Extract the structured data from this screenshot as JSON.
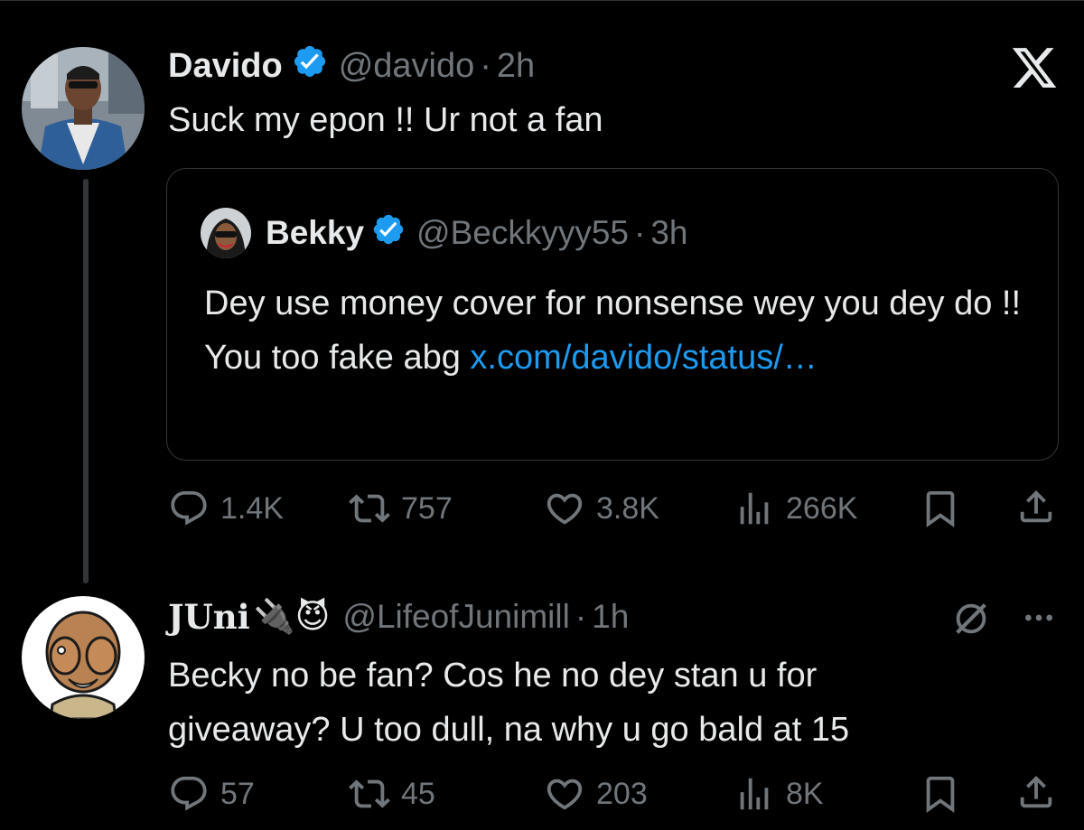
{
  "main_tweet": {
    "name": "Davido",
    "handle": "@davido",
    "sep": "·",
    "time": "2h",
    "text": "Suck my epon !! Ur not a fan",
    "stats": {
      "replies": "1.4K",
      "reposts": "757",
      "likes": "3.8K",
      "views": "266K"
    }
  },
  "quote": {
    "name": "Bekky",
    "handle": "@Beckkyyy55",
    "sep": "·",
    "time": "3h",
    "text": "Dey use money cover for nonsense wey you dey do !! You too fake abg ",
    "link": "x.com/davido/status/…"
  },
  "reply": {
    "name": "JUni",
    "emojis": "🔌😈",
    "handle": "@LifeofJunimill",
    "sep": "·",
    "time": "1h",
    "text_line1": "Becky no be fan? Cos he no dey stan u for",
    "text_line2": "giveaway? U too dull, na why u go bald at 15",
    "stats": {
      "replies": "57",
      "reposts": "45",
      "likes": "203",
      "views": "8K"
    }
  },
  "colors": {
    "bg": "#000000",
    "text": "#e7e9ea",
    "muted": "#71767b",
    "link": "#1d9bf0",
    "verified": "#1d9bf0",
    "border": "#333639"
  }
}
